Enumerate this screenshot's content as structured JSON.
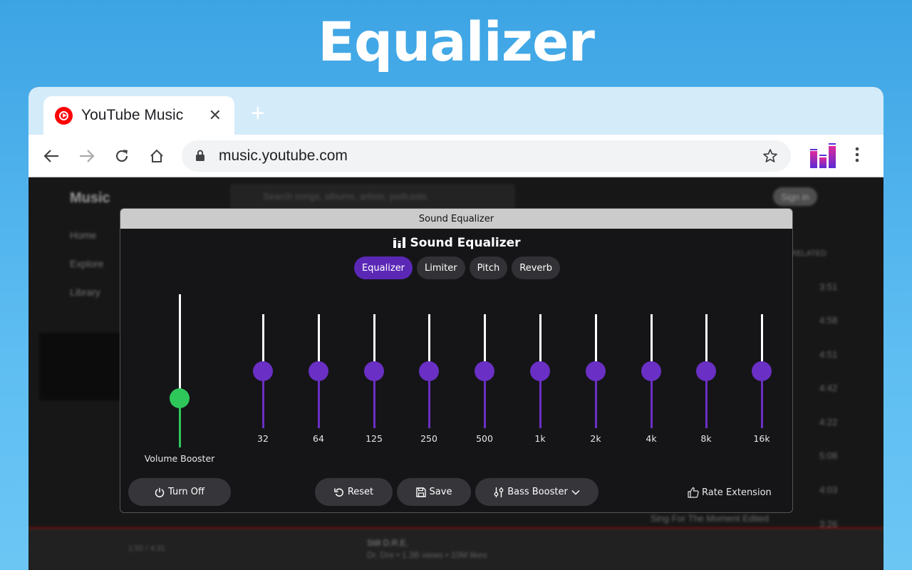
{
  "headline": "Equalizer",
  "browser": {
    "tab_title": "YouTube Music",
    "url": "music.youtube.com"
  },
  "ytm_background": {
    "logo": "Music",
    "search_placeholder": "Search songs, albums, artists, podcasts",
    "nav": [
      "Home",
      "Explore",
      "Library"
    ],
    "sign_in": "Sign in",
    "related": "RELATED",
    "times": [
      "3:51",
      "4:58",
      "4:51",
      "4:42",
      "4:22",
      "5:08",
      "4:03",
      "3:26"
    ],
    "now_playing_title": "Still D.R.E.",
    "now_playing_sub": "Dr. Dre • 1.3B views • 10M likes",
    "playback_time": "1:55 / 4:31",
    "related_song": "Sing For The Moment Edited"
  },
  "equalizer": {
    "window_title": "Sound Equalizer",
    "heading": "Sound Equalizer",
    "tabs": [
      {
        "label": "Equalizer",
        "active": true
      },
      {
        "label": "Limiter",
        "active": false
      },
      {
        "label": "Pitch",
        "active": false
      },
      {
        "label": "Reverb",
        "active": false
      }
    ],
    "volume_label": "Volume Booster",
    "volume_level": 0.32,
    "bands": [
      {
        "label": "32",
        "level": 0.5
      },
      {
        "label": "64",
        "level": 0.5
      },
      {
        "label": "125",
        "level": 0.5
      },
      {
        "label": "250",
        "level": 0.5
      },
      {
        "label": "500",
        "level": 0.5
      },
      {
        "label": "1k",
        "level": 0.5
      },
      {
        "label": "2k",
        "level": 0.5
      },
      {
        "label": "4k",
        "level": 0.5
      },
      {
        "label": "8k",
        "level": 0.5
      },
      {
        "label": "16k",
        "level": 0.5
      }
    ],
    "buttons": {
      "turn_off": "Turn Off",
      "reset": "Reset",
      "save": "Save",
      "bass_booster": "Bass Booster",
      "rate": "Rate Extension"
    },
    "colors": {
      "accent": "#6a2fc4",
      "active_tab": "#5b28b6",
      "volume": "#2ec85a"
    }
  }
}
